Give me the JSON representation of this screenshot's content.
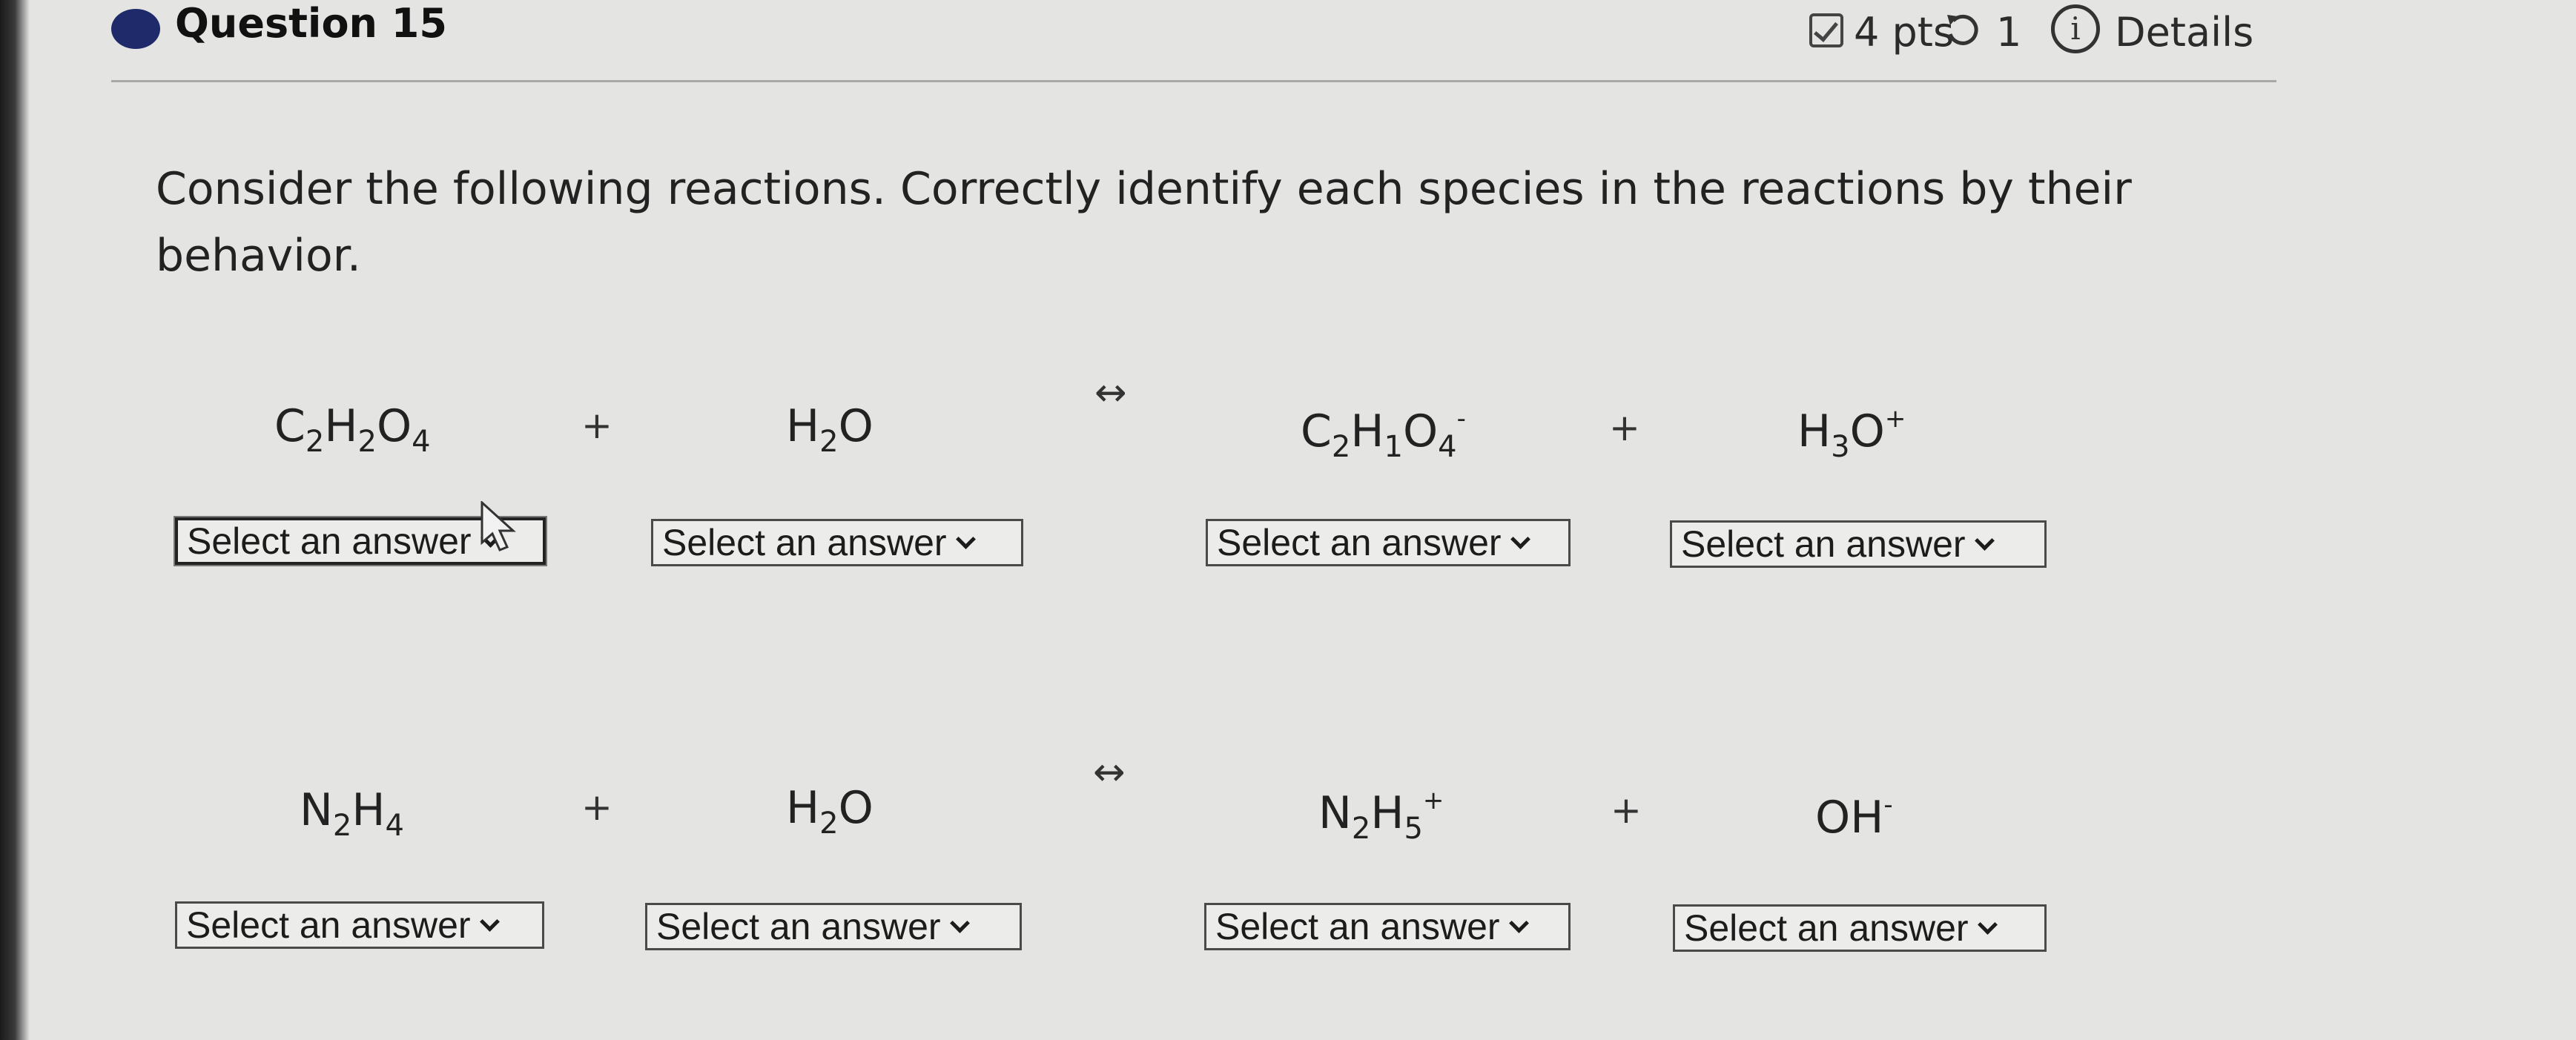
{
  "header": {
    "question_title": "Question 15",
    "points": "4 pts",
    "attempts": "1",
    "details_label": "Details"
  },
  "prompt": "Consider the following reactions. Correctly identify each species in the reactions by their behavior.",
  "operators": {
    "plus": "+",
    "equilibrium": "↔"
  },
  "reactions": [
    {
      "species": [
        {
          "base": "C",
          "parts": [
            "C",
            "2",
            "H",
            "2",
            "O",
            "4",
            ""
          ]
        },
        {
          "text": "H2O"
        },
        {
          "text": "C2H1O4-"
        },
        {
          "text": "H3O+"
        }
      ]
    },
    {
      "species": [
        {
          "text": "N2H4"
        },
        {
          "text": "H2O"
        },
        {
          "text": "N2H5+"
        },
        {
          "text": "OH-"
        }
      ]
    }
  ],
  "formula_parts": {
    "r1": {
      "s1": [
        "C",
        "2",
        "H",
        "2",
        "O",
        "4"
      ],
      "s2": [
        "H",
        "2",
        "O"
      ],
      "s3": [
        "C",
        "2",
        "H",
        "1",
        "O",
        "4",
        "-"
      ],
      "s4": [
        "H",
        "3",
        "O",
        "+"
      ]
    },
    "r2": {
      "s1": [
        "N",
        "2",
        "H",
        "4"
      ],
      "s2": [
        "H",
        "2",
        "O"
      ],
      "s3": [
        "N",
        "2",
        "H",
        "5",
        "+"
      ],
      "s4": [
        "OH",
        "-"
      ]
    }
  },
  "select_placeholder": "Select an answer",
  "colors": {
    "bullet": "#1f2a6b",
    "background": "#e4e4e2"
  },
  "icons": [
    "checkbox-check-icon",
    "retry-icon",
    "info-icon",
    "chevron-down-icon",
    "mouse-cursor-icon"
  ]
}
